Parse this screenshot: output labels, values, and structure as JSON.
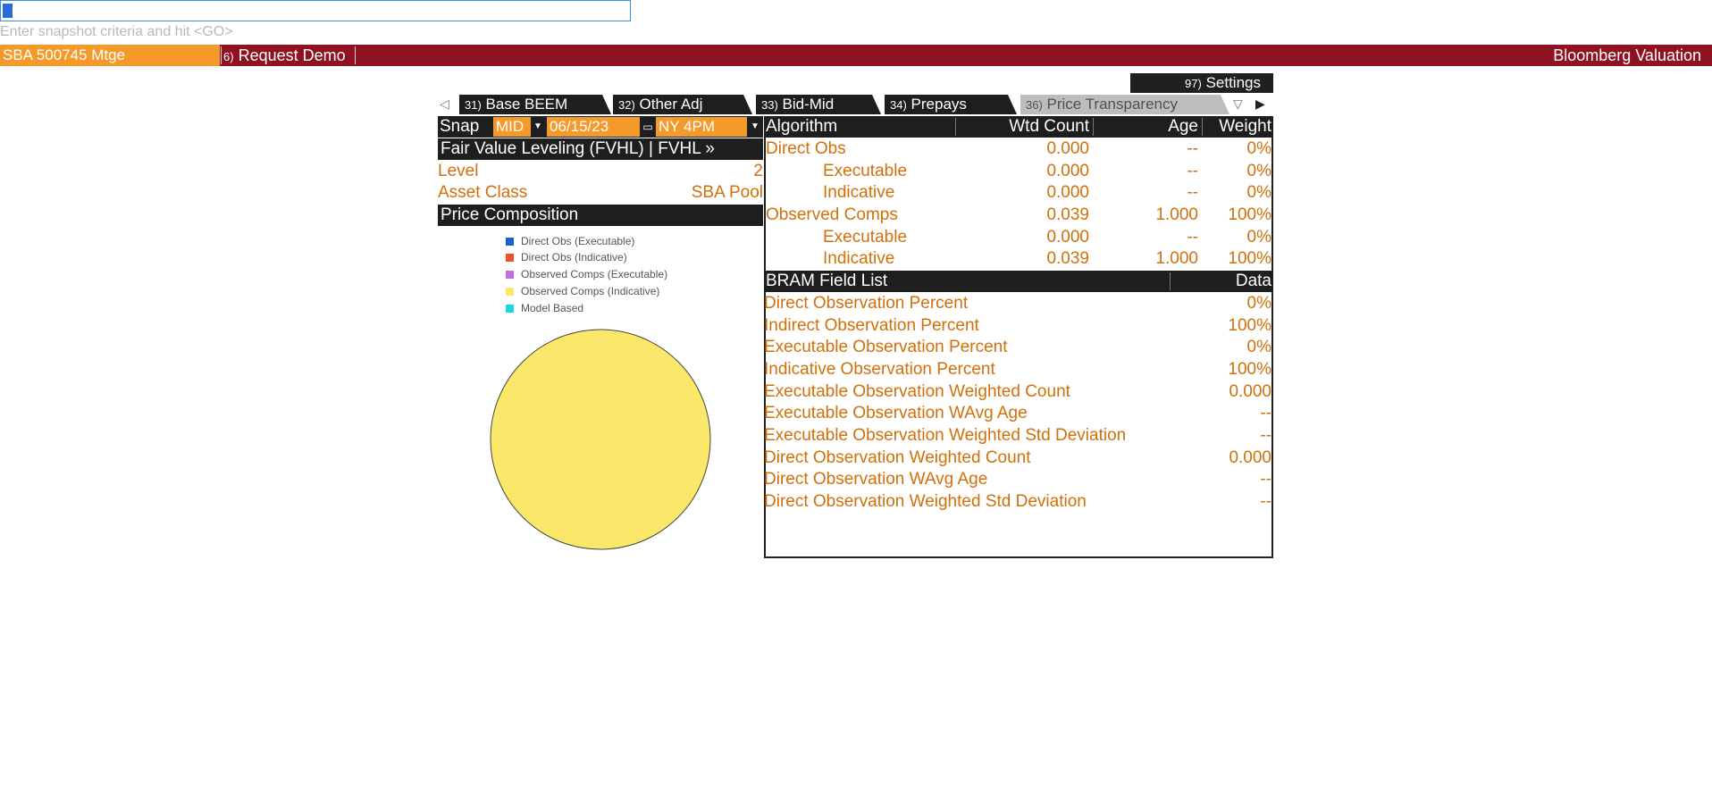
{
  "command_line": {
    "value": "",
    "hint": "Enter snapshot criteria and hit <GO>"
  },
  "top_bar": {
    "security": "SBA 500745 Mtge",
    "request_demo_num": "6)",
    "request_demo_label": "Request Demo",
    "title": "Bloomberg Valuation"
  },
  "settings": {
    "num": "97)",
    "label": "Settings"
  },
  "tabs": [
    {
      "num": "31)",
      "label": "Base BEEM"
    },
    {
      "num": "32)",
      "label": "Other Adj"
    },
    {
      "num": "33)",
      "label": "Bid-Mid"
    },
    {
      "num": "34)",
      "label": "Prepays"
    },
    {
      "num": "36)",
      "label": "Price Transparency"
    }
  ],
  "snap": {
    "label": "Snap",
    "side": "MID",
    "date": "06/15/23",
    "time": "NY 4PM"
  },
  "fvhl": {
    "title": "Fair Value Leveling (FVHL) | FVHL »",
    "level_label": "Level",
    "level_value": "2",
    "asset_class_label": "Asset Class",
    "asset_class_value": "SBA Pool"
  },
  "price_composition": {
    "title": "Price Composition",
    "legend": [
      {
        "label": "Direct Obs (Executable)",
        "color": "#1f5fd6"
      },
      {
        "label": "Direct Obs (Indicative)",
        "color": "#e8552a"
      },
      {
        "label": "Observed Comps (Executable)",
        "color": "#c070e0"
      },
      {
        "label": "Observed Comps (Indicative)",
        "color": "#fbe86b"
      },
      {
        "label": "Model Based",
        "color": "#19d8e6"
      }
    ]
  },
  "algorithm": {
    "headers": {
      "algorithm": "Algorithm",
      "count": "Wtd Count",
      "age": "Age",
      "weight": "Weight"
    },
    "rows": [
      {
        "label": "Direct Obs",
        "count": "0.000",
        "age": "--",
        "weight": "0%"
      },
      {
        "label": "Executable",
        "count": "0.000",
        "age": "--",
        "weight": "0%"
      },
      {
        "label": "Indicative",
        "count": "0.000",
        "age": "--",
        "weight": "0%"
      },
      {
        "label": "Observed Comps",
        "count": "0.039",
        "age": "1.000",
        "weight": "100%"
      },
      {
        "label": "Executable",
        "count": "0.000",
        "age": "--",
        "weight": "0%"
      },
      {
        "label": "Indicative",
        "count": "0.039",
        "age": "1.000",
        "weight": "100%"
      }
    ]
  },
  "bram": {
    "headers": {
      "field": "BRAM Field List",
      "data": "Data"
    },
    "rows": [
      {
        "label": "Direct Observation Percent",
        "value": "0%"
      },
      {
        "label": "Indirect Observation Percent",
        "value": "100%"
      },
      {
        "label": "Executable Observation Percent",
        "value": "0%"
      },
      {
        "label": "Indicative Observation Percent",
        "value": "100%"
      },
      {
        "label": "Executable Observation Weighted Count",
        "value": "0.000"
      },
      {
        "label": "Executable Observation WAvg Age",
        "value": "--"
      },
      {
        "label": "Executable Observation Weighted Std Deviation",
        "value": "--"
      },
      {
        "label": "Direct Observation Weighted Count",
        "value": "0.000"
      },
      {
        "label": "Direct Observation WAvg Age",
        "value": "--"
      },
      {
        "label": "Direct Observation Weighted Std Deviation",
        "value": "--"
      }
    ]
  },
  "pie": {
    "fill": "#fbe86b"
  }
}
